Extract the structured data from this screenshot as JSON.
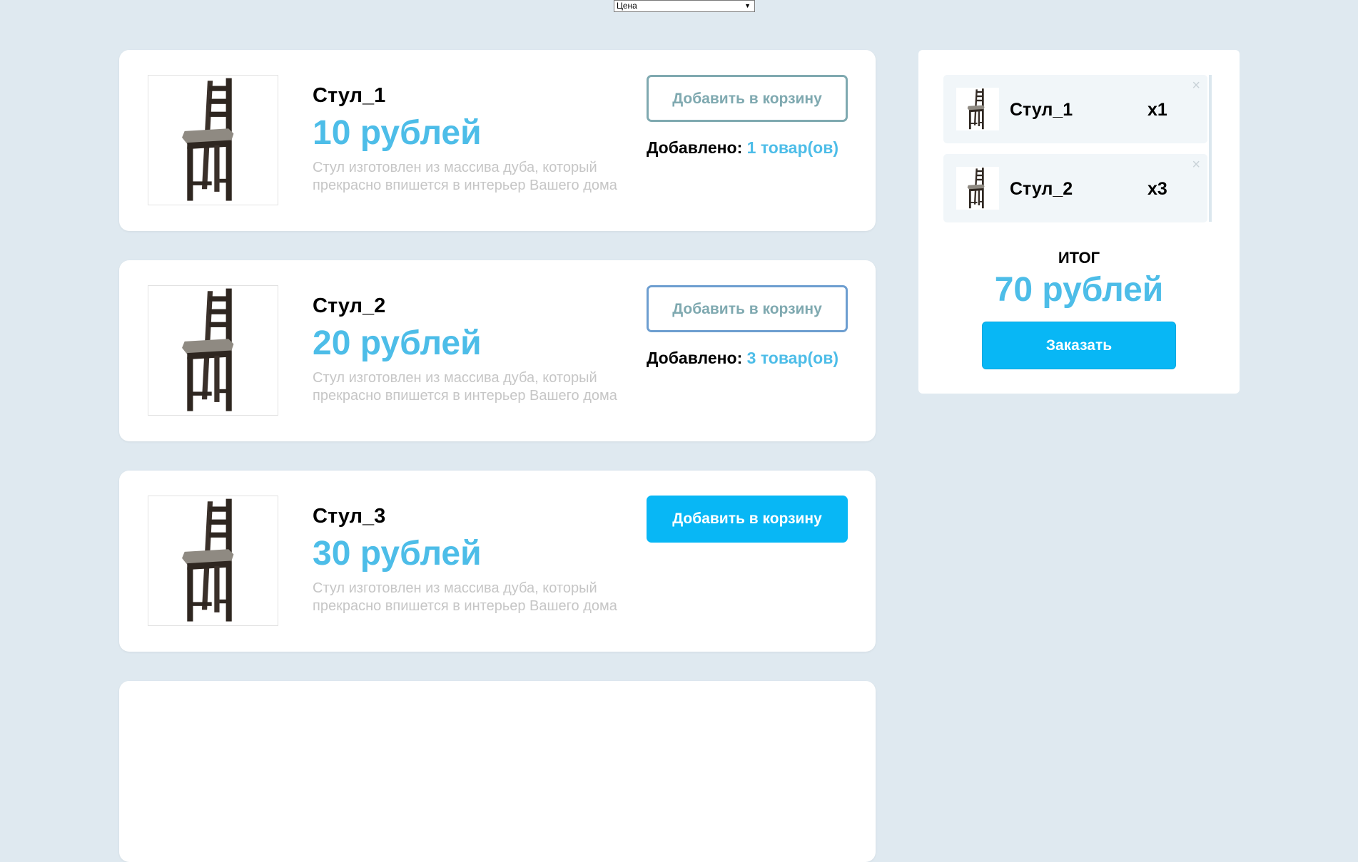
{
  "sort": {
    "selected": "Цена"
  },
  "products": [
    {
      "name": "Стул_1",
      "price": "10 рублей",
      "description": "Стул изготовлен из массива дуба, который прекрасно впишется в интерьер Вашего дома",
      "button_label": "Добавить в корзину",
      "added_label": "Добавлено:",
      "added_count": "1 товар(ов)"
    },
    {
      "name": "Стул_2",
      "price": "20 рублей",
      "description": "Стул изготовлен из массива дуба, который прекрасно впишется в интерьер Вашего дома",
      "button_label": "Добавить в корзину",
      "added_label": "Добавлено:",
      "added_count": "3 товар(ов)"
    },
    {
      "name": "Стул_3",
      "price": "30 рублей",
      "description": "Стул изготовлен из массива дуба, который прекрасно впишется в интерьер Вашего дома",
      "button_label": "Добавить в корзину"
    }
  ],
  "cart": {
    "items": [
      {
        "name": "Стул_1",
        "qty": "x1",
        "remove": "×"
      },
      {
        "name": "Стул_2",
        "qty": "x3",
        "remove": "×"
      }
    ],
    "total_label": "ИТОГ",
    "total_value": "70 рублей",
    "order_label": "Заказать"
  },
  "icons": {
    "product_image": "chair-icon",
    "dropdown": "chevron-down-icon",
    "remove": "close-icon"
  },
  "colors": {
    "accent": "#4dbde8",
    "button": "#08b7f5",
    "background": "#dfe9f0"
  }
}
